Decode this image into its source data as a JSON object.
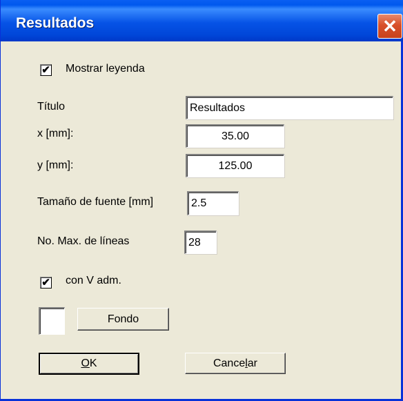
{
  "window": {
    "title": "Resultados",
    "close_glyph": "✕"
  },
  "show_legend": {
    "checked": true,
    "check_glyph": "✔",
    "label": "Mostrar leyenda"
  },
  "fields": {
    "titulo": {
      "label": "Título",
      "value": "Resultados"
    },
    "x": {
      "label": "x [mm]:",
      "value": "35.00"
    },
    "y": {
      "label": "y [mm]:",
      "value": "125.00"
    },
    "font_size": {
      "label": "Tamaño de fuente [mm]",
      "value": "2.5"
    },
    "max_lines": {
      "label": "No. Max. de líneas",
      "value": "28"
    }
  },
  "with_v_adm": {
    "checked": true,
    "check_glyph": "✔",
    "label": "con V adm."
  },
  "background": {
    "button_label": "Fondo",
    "color": "#FFFFFF"
  },
  "buttons": {
    "ok": {
      "label": "OK",
      "accel": "O",
      "rest": "K"
    },
    "cancel": {
      "label": "Cancelar",
      "pre": "Cance",
      "accel": "l",
      "post": "ar"
    }
  }
}
